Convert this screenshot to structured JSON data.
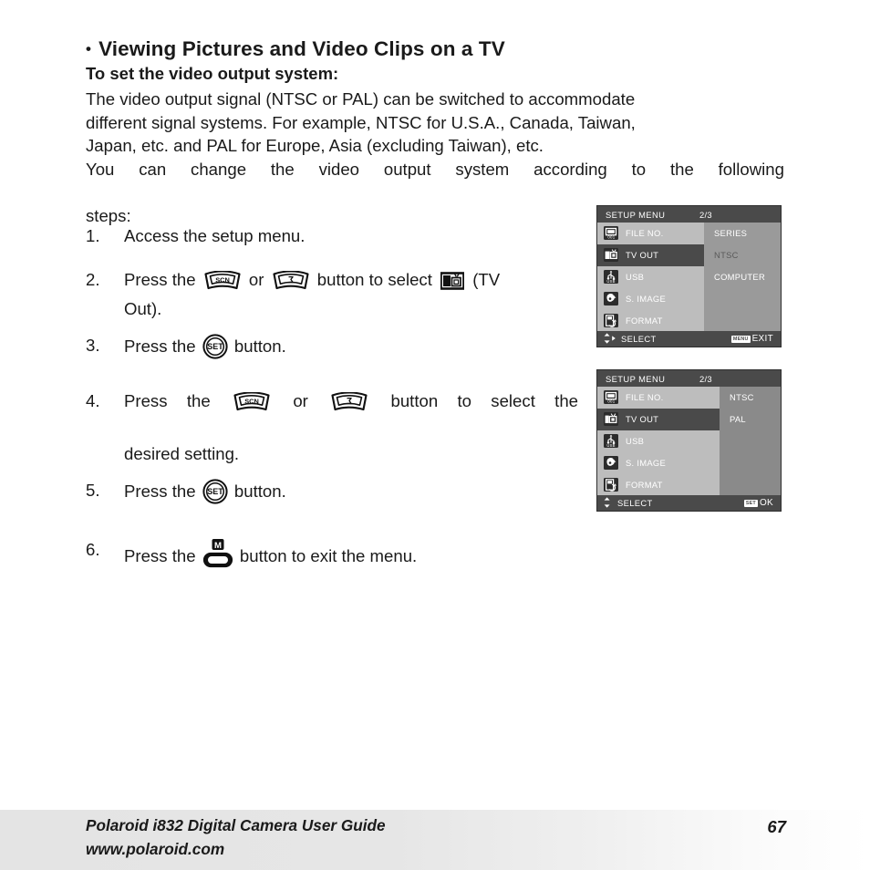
{
  "heading": {
    "bullet": "•",
    "title": "Viewing Pictures and Video Clips on a TV",
    "subtitle": "To set the video output system:"
  },
  "paragraphs": {
    "p1_line1": "The video output signal (NTSC or PAL) can be switched to accommodate",
    "p1_line2": "different signal systems. For example, NTSC for U.S.A., Canada, Taiwan,",
    "p1_line3": "Japan, etc. and PAL for Europe, Asia (excluding Taiwan), etc.",
    "p2_line1": "You can change the video output system according to the following",
    "p2_line2": "steps:"
  },
  "steps": {
    "s1": {
      "num": "1.",
      "text": "Access the setup menu."
    },
    "s2": {
      "num": "2.",
      "pre": "Press the",
      "or": "or",
      "mid": "button to select",
      "post": "(TV",
      "line2": "Out)."
    },
    "s3": {
      "num": "3.",
      "pre": "Press the",
      "post": "button."
    },
    "s4": {
      "num": "4.",
      "pre": "Press the",
      "or": "or",
      "mid": "button to select the",
      "line2": "desired setting."
    },
    "s5": {
      "num": "5.",
      "pre": "Press the",
      "post": "button."
    },
    "s6": {
      "num": "6.",
      "pre": "Press the",
      "post": "button to exit the menu."
    }
  },
  "button_glyphs": {
    "scn_label": "SCN",
    "self_timer_label": "self-timer",
    "set_label": "SET",
    "menu_label": "M"
  },
  "lcd_menu_1": {
    "title": "SETUP MENU",
    "page": "2/3",
    "rows": [
      {
        "icon": "file-no-icon",
        "label": "FILE NO.",
        "value": "SERIES",
        "selected": false,
        "value_dim": false
      },
      {
        "icon": "tv-out-icon",
        "label": "TV OUT",
        "value": "NTSC",
        "selected": true,
        "value_dim": true
      },
      {
        "icon": "usb-icon",
        "label": "USB",
        "value": "COMPUTER",
        "selected": false,
        "value_dim": false
      },
      {
        "icon": "s-image-icon",
        "label": "S. IMAGE",
        "value": "",
        "selected": false,
        "value_dim": false
      },
      {
        "icon": "format-icon",
        "label": "FORMAT",
        "value": "",
        "selected": false,
        "value_dim": false
      }
    ],
    "status_left": "SELECT",
    "status_badge": "MENU",
    "status_right": "EXIT",
    "arrows": "up-down-right"
  },
  "lcd_menu_2": {
    "title": "SETUP MENU",
    "page": "2/3",
    "rows": [
      {
        "icon": "file-no-icon",
        "label": "FILE NO.",
        "value": "NTSC",
        "selected": false,
        "value_dim": false
      },
      {
        "icon": "tv-out-icon",
        "label": "TV OUT",
        "value": "PAL",
        "selected": true,
        "value_dim": false
      },
      {
        "icon": "usb-icon",
        "label": "USB",
        "value": "",
        "selected": false,
        "value_dim": false
      },
      {
        "icon": "s-image-icon",
        "label": "S. IMAGE",
        "value": "",
        "selected": false,
        "value_dim": false
      },
      {
        "icon": "format-icon",
        "label": "FORMAT",
        "value": "",
        "selected": false,
        "value_dim": false
      }
    ],
    "status_left": "SELECT",
    "status_badge": "SET",
    "status_right": "OK",
    "arrows": "up-down"
  },
  "footer": {
    "line1": "Polaroid i832 Digital Camera User Guide",
    "line2": "www.polaroid.com",
    "page_number": "67"
  },
  "colors": {
    "lcd_background": "#9a9a9a",
    "lcd_list": "#bdbdbd",
    "lcd_bar": "#4a4a4a",
    "lcd_border": "#2f2f2f",
    "text": "#1a1a1a",
    "footer_band": "#e4e4e4"
  }
}
